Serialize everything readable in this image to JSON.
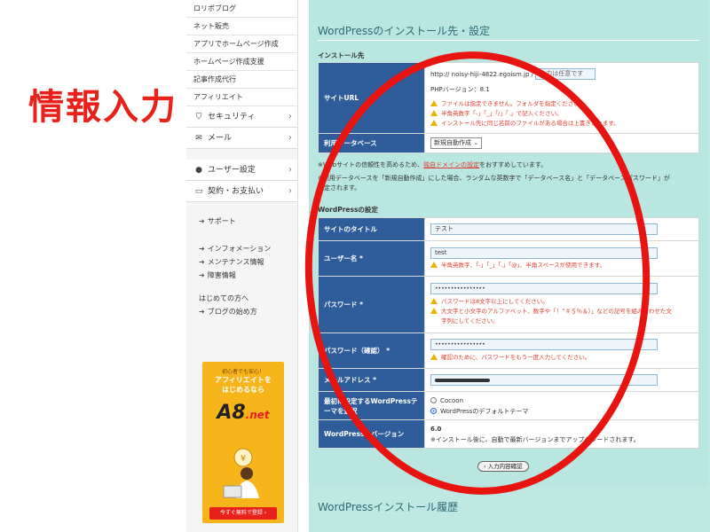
{
  "annotation": {
    "text": "情報入力"
  },
  "sidebar": {
    "top_items": [
      "ロリポブログ",
      "ネット販売",
      "アプリでホームページ作成",
      "ホームページ作成支援",
      "記事作成代行",
      "アフィリエイト"
    ],
    "groups": [
      {
        "label": "セキュリティ",
        "icon": "shield-icon"
      },
      {
        "label": "メール",
        "icon": "mail-icon"
      }
    ],
    "groups2": [
      {
        "label": "ユーザー設定",
        "icon": "user-icon"
      },
      {
        "label": "契約・お支払い",
        "icon": "card-icon"
      }
    ],
    "support": "サポート",
    "info_links": [
      "インフォメーション",
      "メンテナンス情報",
      "障害情報"
    ],
    "beginner": "はじめての方へ",
    "blog_start": "ブログの始め方"
  },
  "banner": {
    "top": "初心者でも安心！",
    "line1": "アフィリエイトを",
    "line2": "はじめるなら",
    "logo": "A8",
    "logo_suffix": ".net",
    "cta": "今すぐ無料で登録 ›"
  },
  "main": {
    "section_title": "WordPressのインストール先・設定",
    "install_heading": "インストール先",
    "site_url_label": "サイトURL",
    "site_url_prefix": "http:// noisy-hiji-4822.egoism.jp /",
    "site_url_input": "入力は任意です",
    "php_version": "PHPバージョン：8.1",
    "url_warnings": [
      "ファイルは指定できません。フォルダを指定ください。",
      "半角英数字「-」「_」「/」「.」で記入ください。",
      "インストール先に同じ名前のファイルがある場合は上書きされます。"
    ],
    "db_label": "利用データベース",
    "db_select": "新規自動作成 ⌄",
    "note1_pre": "※Webサイトの信頼性を高めるため、",
    "note1_link": "独自ドメインの設定",
    "note1_post": "をおすすめしています。",
    "note2": "※利用データベースを「新規自動作成」にした場合、ランダムな英数字で「データベース名」と「データベースパスワード」が",
    "note3": "設定されます。",
    "wp_heading": "WordPressの設定",
    "title_label": "サイトのタイトル",
    "title_value": "テスト",
    "user_label": "ユーザー名 *",
    "user_value": "test",
    "user_warning": "半角英数字、「-」「_」「.」「@」、半角スペースが使用できます。",
    "pass_label": "パスワード *",
    "pass_value": "••••••••••••••••",
    "pass_warnings": [
      "パスワードは8文字以上にしてください。",
      "大文字と小文字のアルファベット、数字や「！”＃＄％＆）」などの記号を組み合わせた文",
      "字列にしてください。"
    ],
    "pass2_label": "パスワード（確認） *",
    "pass2_value": "••••••••••••••••",
    "pass2_warning": "確認のために、パスワードをもう一度入力してください。",
    "mail_label": "メールアドレス *",
    "theme_label_1": "最初に設定するWordPressテ",
    "theme_label_2": "ーマを選択",
    "theme_options": [
      "Cocoon",
      "WordPressのデフォルトテーマ"
    ],
    "version_label": "WordPressのバージョン",
    "version_value": "6.0",
    "version_note": "※インストール後に、自動で最新バージョンまでアップグレードされます。",
    "confirm_button": "› 入力内容確認",
    "history_title": "WordPressインストール履歴"
  }
}
